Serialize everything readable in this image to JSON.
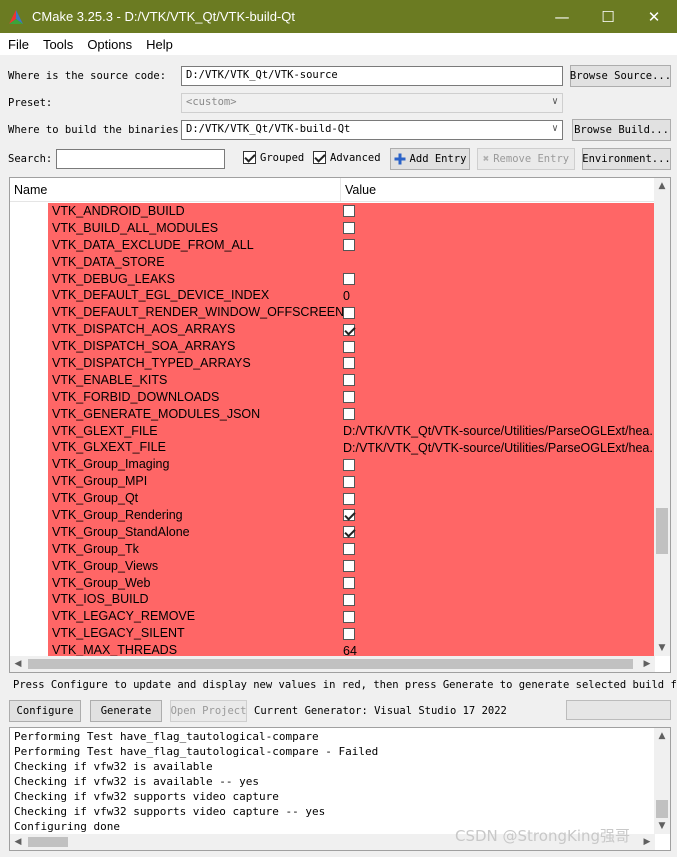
{
  "window": {
    "title": "CMake 3.25.3 - D:/VTK/VTK_Qt/VTK-build-Qt",
    "title_bar_color": "#6b7b22"
  },
  "menu": {
    "items": [
      "File",
      "Tools",
      "Options",
      "Help"
    ]
  },
  "source": {
    "label": "Where is the source code:",
    "value": "D:/VTK/VTK_Qt/VTK-source",
    "browse_label": "Browse Source..."
  },
  "preset": {
    "label": "Preset:",
    "value": "<custom>"
  },
  "build": {
    "label": "Where to build the binaries:",
    "value": "D:/VTK/VTK_Qt/VTK-build-Qt",
    "browse_label": "Browse Build..."
  },
  "toolbar": {
    "search_label": "Search:",
    "search_value": "",
    "grouped_label": "Grouped",
    "grouped_checked": true,
    "advanced_label": "Advanced",
    "advanced_checked": true,
    "add_entry_label": "Add Entry",
    "remove_entry_label": "Remove Entry",
    "environment_label": "Environment..."
  },
  "table": {
    "columns": [
      "Name",
      "Value"
    ],
    "row_highlight_color": "#ff6666",
    "rows": [
      {
        "name": "VTK_ANDROID_BUILD",
        "type": "bool",
        "checked": false
      },
      {
        "name": "VTK_BUILD_ALL_MODULES",
        "type": "bool",
        "checked": false
      },
      {
        "name": "VTK_DATA_EXCLUDE_FROM_ALL",
        "type": "bool",
        "checked": false
      },
      {
        "name": "VTK_DATA_STORE",
        "type": "text",
        "value": ""
      },
      {
        "name": "VTK_DEBUG_LEAKS",
        "type": "bool",
        "checked": false
      },
      {
        "name": "VTK_DEFAULT_EGL_DEVICE_INDEX",
        "type": "text",
        "value": "0"
      },
      {
        "name": "VTK_DEFAULT_RENDER_WINDOW_OFFSCREEN",
        "type": "bool",
        "checked": false
      },
      {
        "name": "VTK_DISPATCH_AOS_ARRAYS",
        "type": "bool",
        "checked": true
      },
      {
        "name": "VTK_DISPATCH_SOA_ARRAYS",
        "type": "bool",
        "checked": false
      },
      {
        "name": "VTK_DISPATCH_TYPED_ARRAYS",
        "type": "bool",
        "checked": false
      },
      {
        "name": "VTK_ENABLE_KITS",
        "type": "bool",
        "checked": false
      },
      {
        "name": "VTK_FORBID_DOWNLOADS",
        "type": "bool",
        "checked": false
      },
      {
        "name": "VTK_GENERATE_MODULES_JSON",
        "type": "bool",
        "checked": false
      },
      {
        "name": "VTK_GLEXT_FILE",
        "type": "text",
        "value": "D:/VTK/VTK_Qt/VTK-source/Utilities/ParseOGLExt/hea..."
      },
      {
        "name": "VTK_GLXEXT_FILE",
        "type": "text",
        "value": "D:/VTK/VTK_Qt/VTK-source/Utilities/ParseOGLExt/hea..."
      },
      {
        "name": "VTK_Group_Imaging",
        "type": "bool",
        "checked": false
      },
      {
        "name": "VTK_Group_MPI",
        "type": "bool",
        "checked": false
      },
      {
        "name": "VTK_Group_Qt",
        "type": "bool",
        "checked": false
      },
      {
        "name": "VTK_Group_Rendering",
        "type": "bool",
        "checked": true
      },
      {
        "name": "VTK_Group_StandAlone",
        "type": "bool",
        "checked": true
      },
      {
        "name": "VTK_Group_Tk",
        "type": "bool",
        "checked": false
      },
      {
        "name": "VTK_Group_Views",
        "type": "bool",
        "checked": false
      },
      {
        "name": "VTK_Group_Web",
        "type": "bool",
        "checked": false
      },
      {
        "name": "VTK_IOS_BUILD",
        "type": "bool",
        "checked": false
      },
      {
        "name": "VTK_LEGACY_REMOVE",
        "type": "bool",
        "checked": false
      },
      {
        "name": "VTK_LEGACY_SILENT",
        "type": "bool",
        "checked": false
      },
      {
        "name": "VTK_MAX_THREADS",
        "type": "text",
        "value": "64"
      }
    ]
  },
  "hint": "Press Configure to update and display new values in red,  then press Generate to generate selected build files.",
  "actions": {
    "configure_label": "Configure",
    "generate_label": "Generate",
    "open_project_label": "Open Project",
    "generator_text": "Current Generator: Visual Studio 17 2022"
  },
  "log": {
    "lines": [
      "Performing Test have_flag_tautological-compare",
      "Performing Test have_flag_tautological-compare - Failed",
      "Checking if vfw32 is available",
      "Checking if vfw32 is available -- yes",
      "Checking if vfw32 supports video capture",
      "Checking if vfw32 supports video capture -- yes",
      "Configuring done"
    ]
  },
  "watermark": "CSDN @StrongKing强哥"
}
